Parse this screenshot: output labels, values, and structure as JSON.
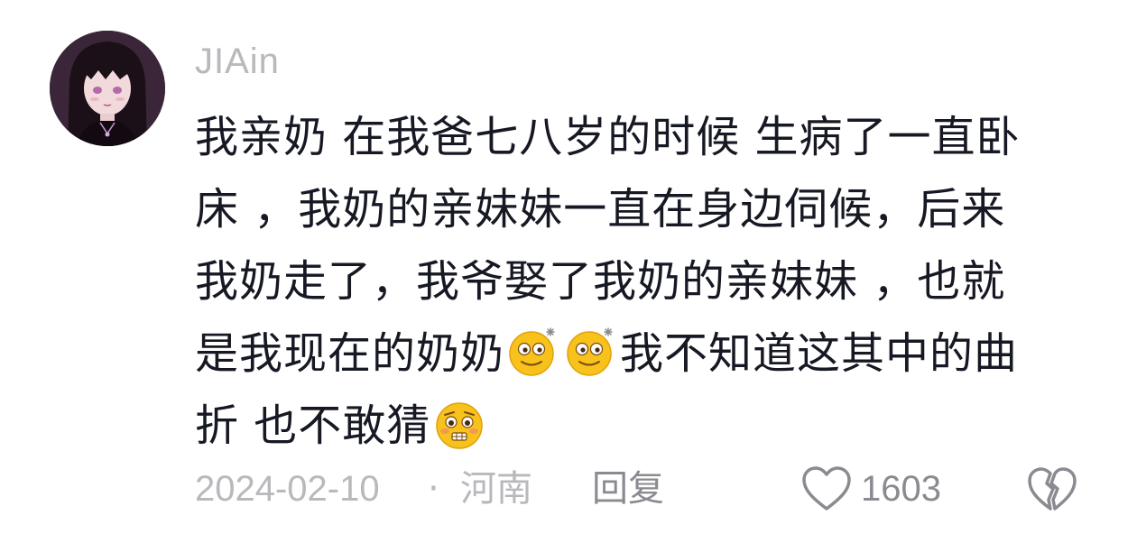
{
  "comment": {
    "username": "JIAin",
    "avatar_icon": "anime-girl-avatar",
    "text_lines": [
      "我亲奶 在我爸七八岁的时候  生病了一直卧",
      "床 ，我奶的亲妹妹一直在身边伺候，后来",
      "我奶走了，我爷娶了我奶的亲妹妹 ，也就",
      "是我现在的奶奶",
      "我不知道这其中的曲",
      "折  也不敢猜"
    ],
    "emojis": [
      "dizzy-smile-emoji",
      "dizzy-smile-emoji",
      "pleading-fear-emoji"
    ],
    "date": "2024-02-10",
    "separator": "·",
    "location": "河南",
    "reply_label": "回复",
    "like_count": "1603",
    "like_icon": "heart-outline-icon",
    "dislike_icon": "broken-heart-icon"
  },
  "colors": {
    "text": "#161823",
    "meta": "#b8b8bd",
    "action": "#8a8b91",
    "background": "#ffffff"
  }
}
